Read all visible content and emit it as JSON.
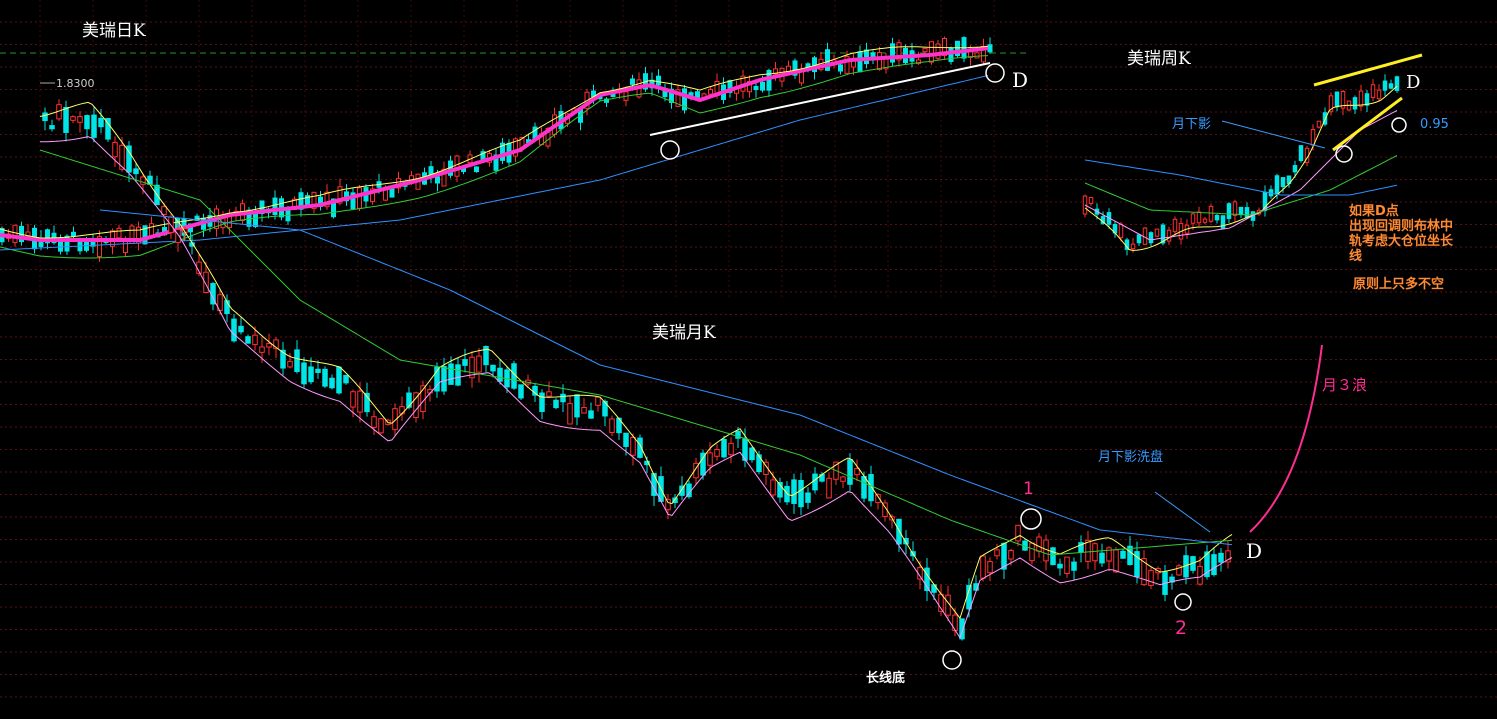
{
  "labels": {
    "daily_title": "美瑞日K",
    "weekly_title": "美瑞周K",
    "monthly_title": "美瑞月K",
    "price_tag": "1.8300",
    "d_daily": "D",
    "d_weekly": "D",
    "d_monthly": "D",
    "weekly_level": "0.95",
    "weekly_lower_shadow": "月下影",
    "monthly_lower_shadow_wash": "月下影洗盘",
    "note_line1": "如果D点",
    "note_line2": "出现回调则布林中",
    "note_line3": "轨考虑大仓位坐长",
    "note_line4": "线",
    "note_principle": "原则上只多不空",
    "wave3": "月３浪",
    "point1": "1",
    "point2": "2",
    "long_bottom": "长线底"
  },
  "colors": {
    "background": "#000000",
    "up_candle": "#ff3030",
    "down_candle": "#00e5e5",
    "ma_magenta": "#ff33cc",
    "ma_blue": "#2f8fff",
    "ma_green": "#33cc33",
    "ma_yellow": "#ffff66",
    "trendline_white": "#ffffff",
    "trendline_yellow": "#ffee22",
    "wave_arrow": "#ff2d92"
  },
  "chart_data": [
    {
      "name": "美瑞日K",
      "type": "candlestick",
      "annotation_price": 1.83,
      "trend": "uptrend after decline",
      "moving_averages": [
        "magenta (thick)",
        "yellow",
        "green",
        "blue"
      ]
    },
    {
      "name": "美瑞周K",
      "type": "candlestick",
      "annotation_level": 0.95
    },
    {
      "name": "美瑞月K",
      "type": "candlestick",
      "trend": "long decline to bottom then base"
    }
  ]
}
